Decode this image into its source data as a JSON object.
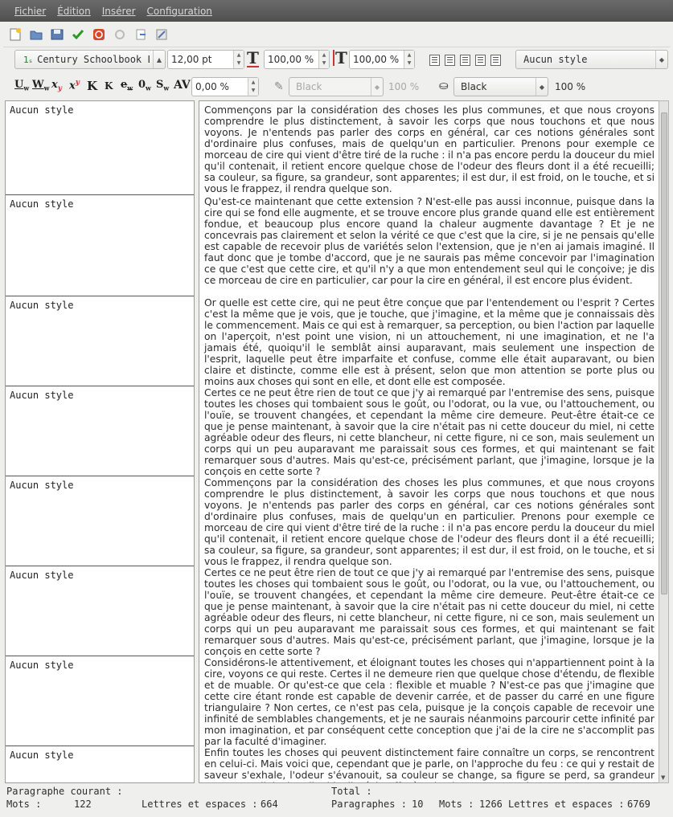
{
  "menu": [
    "Fichier",
    "Édition",
    "Insérer",
    "Configuration"
  ],
  "toolbar": {
    "icons": [
      "new-document-icon",
      "open-folder-icon",
      "save-icon",
      "check-icon",
      "stop-icon",
      "refresh-icon",
      "export-icon",
      "edit-icon"
    ]
  },
  "format": {
    "font_name": "Century Schoolbook L",
    "font_size": "12,00 pt",
    "width_scale": "100,00 %",
    "height_scale": "100,00 %",
    "style_select": "Aucun style",
    "char_spacing": "0,00 %",
    "stroke_color": "Black",
    "stroke_opacity": "100 %",
    "fill_color": "Black",
    "fill_opacity": "100 %"
  },
  "paragraphs": [
    {
      "style": "Aucun style",
      "text": "Commençons par la considération des choses les plus communes, et que nous croyons comprendre le plus distinctement, à savoir les corps que nous touchons et que nous voyons. Je n'entends pas parler des corps en général, car ces notions générales sont d'ordinaire plus confuses, mais de quelqu'un en particulier. Prenons pour exemple ce morceau de cire qui vient d'être tiré de la ruche : il n'a pas encore perdu la douceur du miel qu'il contenait, il retient encore quelque chose de l'odeur des fleurs dont il a été recueilli; sa couleur, sa figure, sa grandeur, sont apparentes; il est dur, il est froid, on le touche, et si vous le frappez, il rendra quelque son."
    },
    {
      "style": "Aucun style",
      "text": "Qu'est-ce maintenant que cette extension ? N'est-elle pas aussi inconnue, puisque dans la cire qui se fond elle augmente, et se trouve encore plus grande quand elle est entièrement fondue, et beaucoup plus encore quand la chaleur augmente davantage ? Et je ne concevrais pas clairement et selon la vérité ce que c'est que la cire, si je ne pensais qu'elle est capable de recevoir plus de variétés selon l'extension, que je n'en ai jamais imaginé. Il faut donc que je tombe d'accord, que je ne saurais pas même concevoir par l'imagination ce que c'est que cette cire, et qu'il n'y a que mon entendement seul qui le conçoive; je dis ce morceau de cire en particulier, car pour la cire en général, il est encore plus évident."
    },
    {
      "style": "Aucun style",
      "text": "Or quelle est cette cire, qui ne peut être conçue que par l'entendement ou l'esprit ? Certes c'est la même que je vois, que je touche, que j'imagine, et la même que je connaissais dès le commencement. Mais ce qui est à remarquer, sa perception, ou bien l'action par laquelle on l'aperçoit, n'est point une vision, ni un attouchement, ni une imagination, et ne l'a jamais été, quoiqu'il le semblât ainsi auparavant, mais seulement une inspection de l'esprit, laquelle peut être imparfaite et confuse, comme elle était auparavant, ou bien claire et distincte, comme elle est à présent, selon que mon attention se porte plus ou moins aux choses qui sont en elle, et dont elle est composée."
    },
    {
      "style": "Aucun style",
      "text": "Certes ce ne peut être rien de tout ce que j'y ai remarqué par l'entremise des sens, puisque toutes les choses qui tombaient sous le goût, ou l'odorat, ou la vue, ou l'attouchement, ou l'ouïe, se trouvent changées, et cependant la même cire demeure. Peut-être était-ce ce que je pense maintenant, à savoir que la cire n'était pas ni cette douceur du miel, ni cette agréable odeur des fleurs, ni cette blancheur, ni cette figure, ni ce son, mais seulement un corps qui un peu auparavant me paraissait sous ces formes, et qui maintenant se fait remarquer sous d'autres. Mais qu'est-ce, précisément parlant, que j'imagine, lorsque je la conçois en cette sorte ?"
    },
    {
      "style": "Aucun style",
      "text": "Commençons par la considération des choses les plus communes, et que nous croyons comprendre le plus distinctement, à savoir les corps que nous touchons et que nous voyons. Je n'entends pas parler des corps en général, car ces notions générales sont d'ordinaire plus confuses, mais de quelqu'un en particulier. Prenons pour exemple ce morceau de cire qui vient d'être tiré de la ruche : il n'a pas encore perdu la douceur du miel qu'il contenait, il retient encore quelque chose de l'odeur des fleurs dont il a été recueilli; sa couleur, sa figure, sa grandeur, sont apparentes; il est dur, il est froid, on le touche, et si vous le frappez, il rendra quelque son."
    },
    {
      "style": "Aucun style",
      "text": "Certes ce ne peut être rien de tout ce que j'y ai remarqué par l'entremise des sens, puisque toutes les choses qui tombaient sous le goût, ou l'odorat, ou la vue, ou l'attouchement, ou l'ouïe, se trouvent changées, et cependant la même cire demeure. Peut-être était-ce ce que je pense maintenant, à savoir que la cire n'était pas ni cette douceur du miel, ni cette agréable odeur des fleurs, ni cette blancheur, ni cette figure, ni ce son, mais seulement un corps qui un peu auparavant me paraissait sous ces formes, et qui maintenant se fait remarquer sous d'autres. Mais qu'est-ce, précisément parlant, que j'imagine, lorsque je la conçois en cette sorte ?"
    },
    {
      "style": "Aucun style",
      "text": "Considérons-le attentivement, et éloignant toutes les choses qui n'appartiennent point à la cire, voyons ce qui reste. Certes il ne demeure rien que quelque chose d'étendu, de flexible et de muable. Or qu'est-ce que cela : flexible et muable ? N'est-ce pas que j'imagine que cette cire étant ronde est capable de devenir carrée, et de passer du carré en une figure triangulaire ? Non certes, ce n'est pas cela, puisque je la conçois capable de recevoir une infinité de semblables changements, et je ne saurais néanmoins parcourir cette infinité par mon imagination, et par conséquent cette conception que j'ai de la cire ne s'accomplit pas par la faculté d'imaginer."
    },
    {
      "style": "Aucun style",
      "text": "Enfin toutes les choses qui peuvent distinctement faire connaître un corps, se rencontrent en celui-ci. Mais voici que, cependant que je parle, on l'approche du feu : ce qui y restait de saveur s'exhale, l'odeur s'évanouit, sa couleur se change, sa figure se perd, sa grandeur augmente, il devient liquide, il s'échauffe, à peine le peut-on toucher"
    }
  ],
  "status": {
    "current_label": "Paragraphe courant :",
    "total_label": "Total :",
    "words_label": "Mots :",
    "words_current": "122",
    "letters_label": "Lettres et espaces :",
    "letters_current": "664",
    "paragraphs_label": "Paragraphes :",
    "paragraphs_total": "10",
    "words_total_label": "Mots :",
    "words_total": "1266",
    "letters_total_label": "Lettres et espaces :",
    "letters_total": "6769"
  }
}
